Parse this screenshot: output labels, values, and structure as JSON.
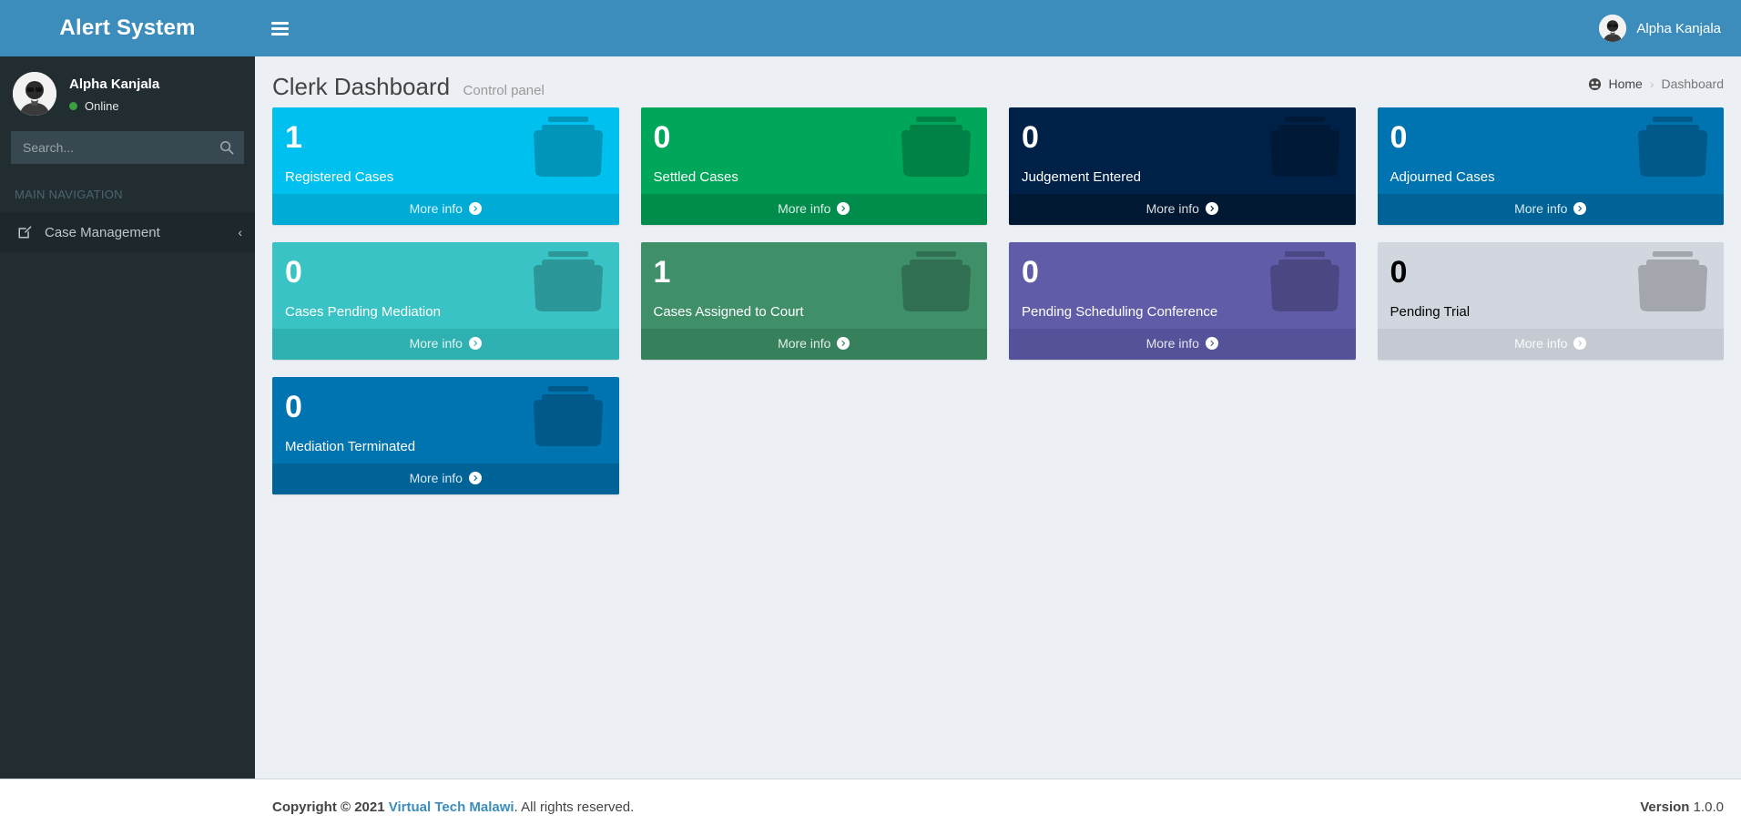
{
  "brand": {
    "title": "Alert System"
  },
  "sidebar": {
    "user": {
      "name": "Alpha Kanjala",
      "status": "Online",
      "avatar_icon": "user-avatar"
    },
    "search": {
      "placeholder": "Search...",
      "value": "",
      "icon": "search-icon"
    },
    "nav_header": "MAIN NAVIGATION",
    "items": [
      {
        "label": "Case Management",
        "icon": "edit-square-icon",
        "caret": "‹"
      }
    ]
  },
  "topbar": {
    "menu_icon": "hamburger-icon",
    "user_name": "Alpha Kanjala",
    "avatar_icon": "user-avatar"
  },
  "header": {
    "title": "Clerk Dashboard",
    "subtitle": "Control panel",
    "breadcrumb": {
      "home_icon": "dashboard-icon",
      "home": "Home",
      "separator": "›",
      "current": "Dashboard"
    }
  },
  "cards": [
    {
      "number": "1",
      "label": "Registered Cases",
      "more_info": "More info",
      "bg": "#00c0ef",
      "footer_bg": "#00acd6",
      "icon": "inbox-icon",
      "text_style": "light"
    },
    {
      "number": "0",
      "label": "Settled Cases",
      "more_info": "More info",
      "bg": "#00a65a",
      "footer_bg": "#008d4c",
      "icon": "inbox-icon",
      "text_style": "light"
    },
    {
      "number": "0",
      "label": "Judgement Entered",
      "more_info": "More info",
      "bg": "#002147",
      "footer_bg": "#001832",
      "icon": "inbox-icon",
      "text_style": "light"
    },
    {
      "number": "0",
      "label": "Adjourned Cases",
      "more_info": "More info",
      "bg": "#0073b1",
      "footer_bg": "#006397",
      "icon": "inbox-icon",
      "text_style": "light"
    },
    {
      "number": "0",
      "label": "Cases Pending Mediation",
      "more_info": "More info",
      "bg": "#39c3c4",
      "footer_bg": "#2fb0b1",
      "icon": "inbox-icon",
      "text_style": "light"
    },
    {
      "number": "1",
      "label": "Cases Assigned to Court",
      "more_info": "More info",
      "bg": "#3f9069",
      "footer_bg": "#36805c",
      "icon": "inbox-icon",
      "text_style": "light"
    },
    {
      "number": "0",
      "label": "Pending Scheduling Conference",
      "more_info": "More info",
      "bg": "#605ca8",
      "footer_bg": "#555299",
      "icon": "inbox-icon",
      "text_style": "light"
    },
    {
      "number": "0",
      "label": "Pending Trial",
      "more_info": "More info",
      "bg": "#d2d6de",
      "footer_bg": "#c5c9d1",
      "icon": "inbox-icon",
      "text_style": "dark"
    },
    {
      "number": "0",
      "label": "Mediation Terminated",
      "more_info": "More info",
      "bg": "#0073b1",
      "footer_bg": "#006397",
      "icon": "inbox-icon",
      "text_style": "light"
    }
  ],
  "footer": {
    "copyright_prefix": "Copyright © 2021",
    "company": "Virtual Tech Malawi",
    "copyright_suffix": ". All rights reserved.",
    "version_label": "Version",
    "version_number": "1.0.0"
  },
  "colors": {
    "brand_blue": "#3c8dbc",
    "sidebar_dark": "#222d32",
    "content_bg": "#ecf0f5",
    "link": "#3c8dbc"
  }
}
